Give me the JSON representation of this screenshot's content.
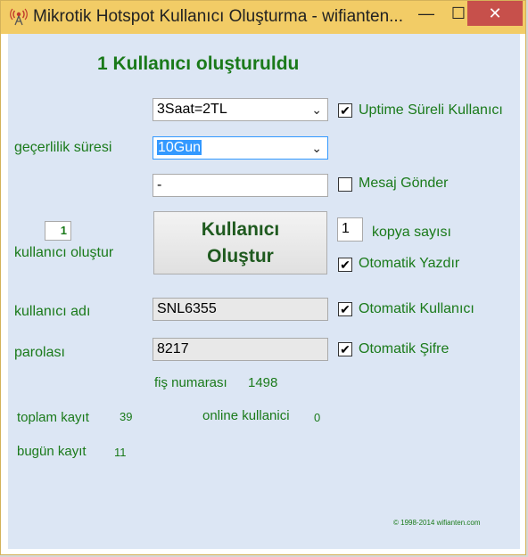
{
  "window": {
    "title": "Mikrotik Hotspot Kullanıcı Oluşturma - wifianten...",
    "min_glyph": "—",
    "max_glyph": "☐",
    "close_glyph": "✕"
  },
  "heading": "1 Kullanıcı oluşturuldu",
  "profile_select": {
    "value": "3Saat=2TL"
  },
  "uptime_checkbox": {
    "label": "Uptime Süreli Kullanıcı",
    "checked": "✔"
  },
  "validity": {
    "label": "geçerlilik süresi",
    "value": "10Gun"
  },
  "message_field": {
    "value": "-"
  },
  "message_checkbox": {
    "label": "Mesaj Gönder",
    "checked": ""
  },
  "count": {
    "value": "1",
    "label": "kullanıcı oluştur"
  },
  "create_button": {
    "line1": "Kullanıcı",
    "line2": "Oluştur"
  },
  "copies": {
    "value": "1",
    "label": "kopya sayısı"
  },
  "auto_print": {
    "label": "Otomatik Yazdır",
    "checked": "✔"
  },
  "username": {
    "label": "kullanıcı adı",
    "value": "SNL6355"
  },
  "auto_user": {
    "label": "Otomatik Kullanıcı",
    "checked": "✔"
  },
  "password": {
    "label": "parolası",
    "value": "8217"
  },
  "auto_pass": {
    "label": "Otomatik Şifre",
    "checked": "✔"
  },
  "receipt": {
    "label": "fiş numarası",
    "value": "1498"
  },
  "total": {
    "label": "toplam kayıt",
    "value": "39"
  },
  "online": {
    "label": "online kullanici",
    "value": "0"
  },
  "today": {
    "label": "bugün kayıt",
    "value": "11"
  },
  "footer": {
    "copyright": "© 1998-2014 wifianten.com"
  },
  "colors": {
    "label_green": "#1a7a1a",
    "titlebar": "#f2cc66",
    "client_bg": "#dce6f4",
    "close_red": "#c7504b"
  },
  "icons": {
    "app": "antenna-icon",
    "dropdown": "chevron-down-icon"
  }
}
